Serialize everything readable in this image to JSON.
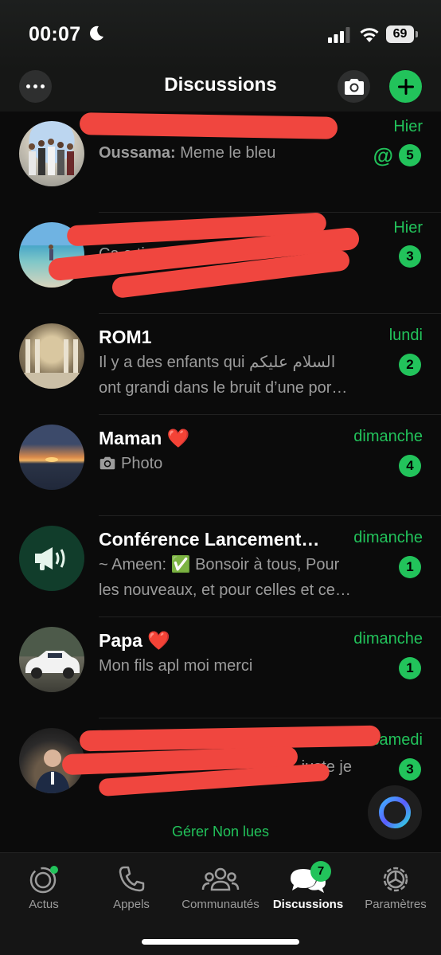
{
  "status_bar": {
    "time": "00:07",
    "battery": "69"
  },
  "header": {
    "title": "Discussions"
  },
  "chats": [
    {
      "name": "",
      "date": "Hier",
      "preview_sender": "Oussama:",
      "preview": " Meme le bleu",
      "unread": "5",
      "mention": "@"
    },
    {
      "name": "",
      "date": "Hier",
      "preview": "Ca a ti... ap...",
      "unread": "3"
    },
    {
      "name": "ROM1",
      "date": "lundi",
      "preview_line1": "Il y a des enfants qui  السلام عليكم",
      "preview_line2": "ont grandi dans le bruit d’une por…",
      "unread": "2"
    },
    {
      "name": "Maman ❤️",
      "date": "dimanche",
      "preview": "Photo",
      "unread": "4"
    },
    {
      "name": "Conférence Lancement…",
      "date": "dimanche",
      "preview_line1": "~ Ameen: ✅ Bonsoir à tous, Pour",
      "preview_line2": "les nouveaux, et pour celles et ce…",
      "unread": "1"
    },
    {
      "name": "Papa ❤️",
      "date": "dimanche",
      "preview": "Mon fils apl moi merci",
      "unread": "1"
    },
    {
      "name": "",
      "date": "samedi",
      "preview": "juste je",
      "unread": "3"
    }
  ],
  "manage_unread": "Gérer Non lues",
  "tabs": [
    {
      "label": "Actus",
      "icon": "status-icon"
    },
    {
      "label": "Appels",
      "icon": "phone-icon"
    },
    {
      "label": "Communautés",
      "icon": "communities-icon"
    },
    {
      "label": "Discussions",
      "icon": "chats-icon",
      "badge": "7",
      "active": true
    },
    {
      "label": "Paramètres",
      "icon": "settings-icon"
    }
  ],
  "colors": {
    "accent": "#22c35b",
    "background": "#0b0b0b",
    "redaction": "#f0463f"
  }
}
